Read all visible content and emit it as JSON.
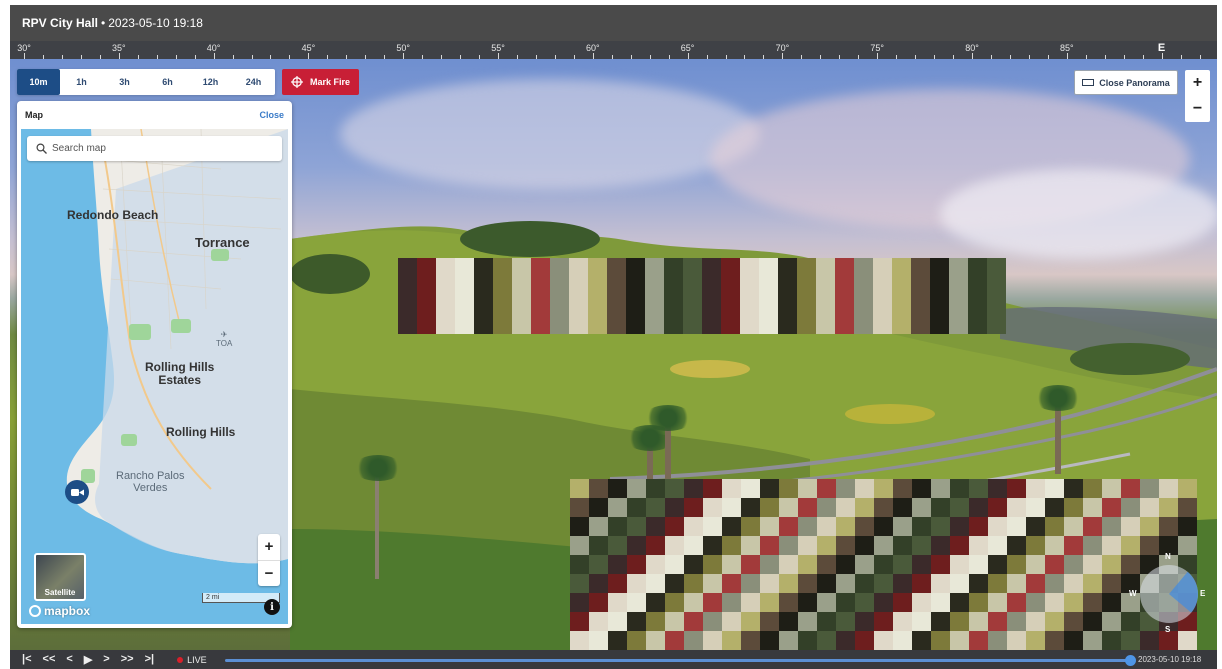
{
  "header": {
    "camera_name": "RPV City Hall",
    "separator": "•",
    "timestamp": "2023-05-10 19:18"
  },
  "ruler": {
    "labels": [
      "30°",
      "35°",
      "40°",
      "45°",
      "50°",
      "55°",
      "60°",
      "65°",
      "70°",
      "75°",
      "80°",
      "85°",
      "E"
    ]
  },
  "time_ranges": {
    "items": [
      "10m",
      "1h",
      "3h",
      "6h",
      "12h",
      "24h"
    ],
    "active": "10m"
  },
  "mark_fire": {
    "label": "Mark Fire",
    "color": "#c81f36"
  },
  "map": {
    "title": "Map",
    "close_label": "Close",
    "search_placeholder": "Search map",
    "labels": {
      "redondo": "Redondo Beach",
      "torrance": "Torrance",
      "toa": "TOA",
      "rhe_line1": "Rolling Hills",
      "rhe_line2": "Estates",
      "rolling_hills": "Rolling Hills",
      "rpv_line1": "Rancho Palos",
      "rpv_line2": "Verdes"
    },
    "zoom_in": "+",
    "zoom_out": "−",
    "satellite_label": "Satellite",
    "scale_label": "2 mi",
    "info": "i",
    "attribution": "mapbox"
  },
  "panorama": {
    "close_label": "Close Panorama",
    "zoom_in": "+",
    "zoom_out": "−"
  },
  "compass": {
    "n": "N",
    "e": "E",
    "s": "S",
    "w": "W"
  },
  "playback": {
    "controls": [
      "|<",
      "<<",
      "<",
      "▶",
      ">",
      ">>",
      ">|"
    ],
    "live_label": "LIVE",
    "timestamp": "2023-05-10 19:18",
    "position": 0.99
  },
  "colors": {
    "accent": "#1d4d86",
    "title_bar": "#4a4a4a",
    "map_water": "#6dbbe6"
  }
}
